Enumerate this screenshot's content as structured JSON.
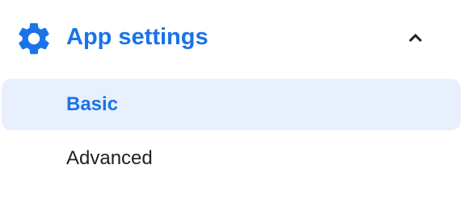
{
  "section": {
    "title": "App settings",
    "icon": "gear-icon",
    "toggle_icon": "chevron-up-icon",
    "expanded": true
  },
  "nav": {
    "items": [
      {
        "label": "Basic",
        "selected": true
      },
      {
        "label": "Advanced",
        "selected": false
      }
    ]
  },
  "colors": {
    "accent": "#1a73e8",
    "selected_background": "#e8f0fe",
    "text": "#202124",
    "background": "#ffffff"
  }
}
